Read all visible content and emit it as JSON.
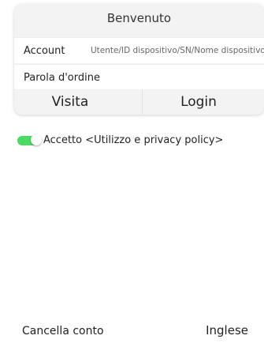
{
  "header": {
    "title": "Benvenuto"
  },
  "form": {
    "account_label": "Account",
    "account_placeholder": "Utente/ID dispositivo/SN/Nome dispositivo",
    "password_label": "Parola d'ordine",
    "password_placeholder": ""
  },
  "buttons": {
    "visit_label": "Visita",
    "login_label": "Login"
  },
  "agreement": {
    "toggle_on": true,
    "text": "Accetto <Utilizzo e privacy policy>",
    "toggle_color": "#4cd964"
  },
  "footer": {
    "cancel_account_label": "Cancella conto",
    "language_label": "Inglese"
  }
}
